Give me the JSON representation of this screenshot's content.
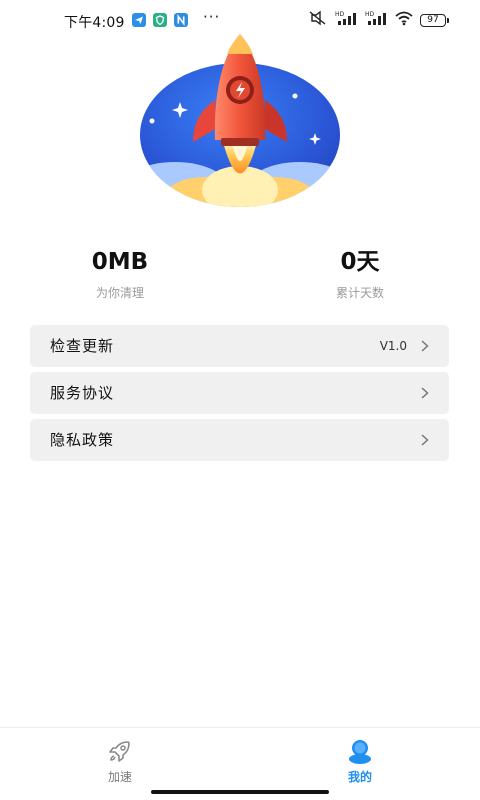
{
  "status_bar": {
    "time": "下午4:09",
    "battery": "97",
    "app_icons": [
      "paper-plane-icon",
      "shield-icon",
      "n-app-icon"
    ],
    "more": "···"
  },
  "stats": [
    {
      "value": "0MB",
      "label": "为你清理"
    },
    {
      "value": "0天",
      "label": "累计天数"
    }
  ],
  "menu": {
    "items": [
      {
        "label": "检查更新",
        "value": "V1.0"
      },
      {
        "label": "服务协议",
        "value": ""
      },
      {
        "label": "隐私政策",
        "value": ""
      }
    ]
  },
  "nav": {
    "items": [
      {
        "label": "加速",
        "icon": "rocket-outline-icon",
        "active": false
      },
      {
        "label": "我的",
        "icon": "user-icon",
        "active": true
      }
    ]
  },
  "colors": {
    "accent": "#1f8ff0",
    "inactive": "#7a7a7a",
    "card": "#f0f0f0"
  }
}
